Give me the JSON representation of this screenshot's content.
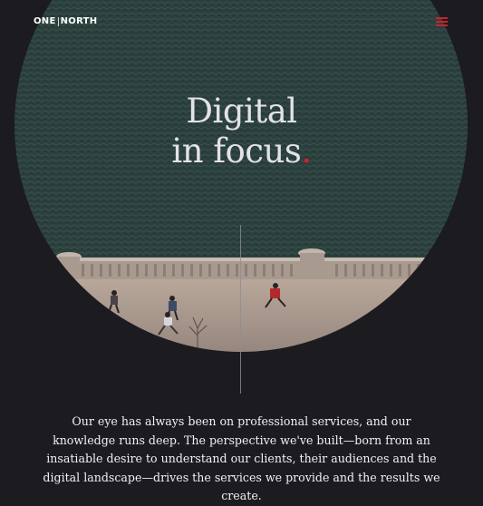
{
  "header": {
    "logo_left": "ONE",
    "logo_right": "NORTH",
    "menu_icon": "hamburger-icon"
  },
  "hero": {
    "line1": "Digital",
    "line2": "in focus",
    "dot": "."
  },
  "intro": {
    "text": "Our eye has always been on professional services, and our knowledge runs deep. The perspective we've built—born from an insatiable desire to understand our clients, their audiences and the digital landscape—drives the services we provide and the results we create."
  },
  "colors": {
    "background": "#1c1b20",
    "accent": "#c8232c",
    "water": "#2e4643"
  }
}
